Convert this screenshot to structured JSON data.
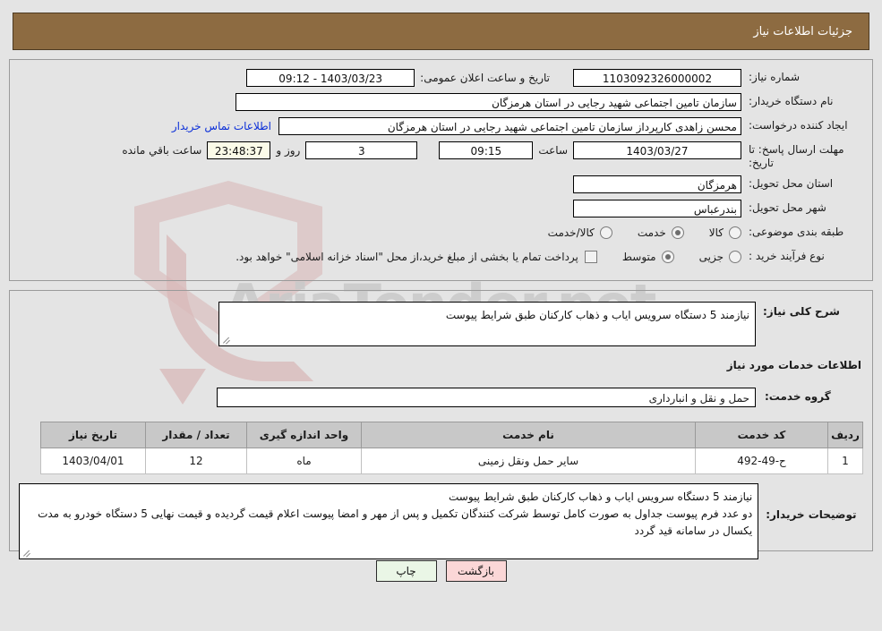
{
  "header": {
    "title": "جزئیات اطلاعات نیاز"
  },
  "watermark": {
    "text": "AriaTender.net"
  },
  "form": {
    "need_number": {
      "label": "شماره نیاز:",
      "value": "1103092326000002"
    },
    "public_announce": {
      "label": "تاریخ و ساعت اعلان عمومی:",
      "value": "1403/03/23 - 09:12"
    },
    "buyer_org": {
      "label": "نام دستگاه خریدار:",
      "value": "سازمان تامین اجتماعی شهید رجایی در استان هرمزگان"
    },
    "creator": {
      "label": "ایجاد کننده درخواست:",
      "value": "محسن زاهدی کارپرداز سازمان تامین اجتماعی شهید رجایی در استان هرمزگان",
      "contact_link": "اطلاعات تماس خریدار"
    },
    "deadline": {
      "label": "مهلت ارسال پاسخ: تا تاریخ:",
      "date": "1403/03/27",
      "time_label": "ساعت",
      "time": "09:15",
      "days": "3",
      "days_label": "روز و",
      "remaining": "23:48:37",
      "remaining_label": "ساعت باقي مانده"
    },
    "province": {
      "label": "استان محل تحویل:",
      "value": "هرمزگان"
    },
    "city": {
      "label": "شهر محل تحویل:",
      "value": "بندرعباس"
    },
    "category": {
      "label": "طبقه بندی موضوعی:",
      "options": [
        {
          "label": "کالا",
          "selected": false
        },
        {
          "label": "خدمت",
          "selected": true
        },
        {
          "label": "کالا/خدمت",
          "selected": false
        }
      ]
    },
    "purchase_process": {
      "label": "نوع فرآیند خرید :",
      "options": [
        {
          "label": "جزیی",
          "selected": false
        },
        {
          "label": "متوسط",
          "selected": true
        }
      ],
      "checkbox_note": "پرداخت تمام یا بخشی از مبلغ خرید،از محل \"اسناد خزانه اسلامی\" خواهد بود.",
      "checkbox_checked": false
    }
  },
  "details": {
    "general_desc_label": "شرح کلی نیاز:",
    "general_desc_value": "نیازمند 5 دستگاه سرویس ایاب و ذهاب کارکنان طبق شرایط پیوست",
    "services_title": "اطلاعات خدمات مورد نیاز",
    "service_group_label": "گروه خدمت:",
    "service_group_value": "حمل و نقل و انبارداری",
    "buyer_notes_label": "توضیحات خریدار:",
    "buyer_notes_value": "نیازمند 5 دستگاه سرویس ایاب و ذهاب کارکنان طبق شرایط پیوست\nدو عدد فرم پیوست جداول به صورت کامل توسط شرکت کنندگان تکمیل و پس از مهر و امضا پیوست اعلام قیمت گردیده و قیمت نهایی 5 دستگاه خودرو به مدت یکسال در سامانه قید گردد"
  },
  "table": {
    "columns": [
      "ردیف",
      "کد خدمت",
      "نام خدمت",
      "واحد اندازه گیری",
      "تعداد / مقدار",
      "تاریخ نیاز"
    ],
    "rows": [
      {
        "radif": "1",
        "code": "ح-49-492",
        "name": "سایر حمل ونقل زمینی",
        "unit": "ماه",
        "qty": "12",
        "date": "1403/04/01"
      }
    ]
  },
  "footer": {
    "back_label": "بازگشت",
    "print_label": "چاپ"
  },
  "colors": {
    "header_bg": "#8d6b41",
    "link": "#0b2fd8",
    "back_btn": "#fbd7d7",
    "print_btn": "#eaf6e6",
    "table_header": "#c8c8c8",
    "page_bg": "#e4e4e4"
  }
}
